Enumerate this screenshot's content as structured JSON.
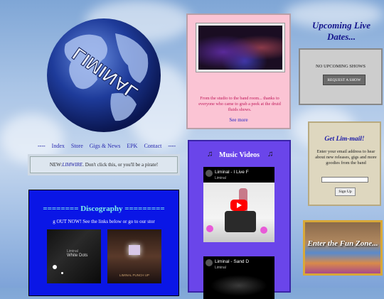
{
  "nav": {
    "dash_left": "----",
    "dash_right": "----",
    "items": [
      "Index",
      "Store",
      "Gigs & News",
      "EPK",
      "Contact"
    ]
  },
  "pirate": {
    "prefix": "NEW: ",
    "link": "LIMWIRE",
    "suffix": ". Don't click this, or you'll be a pirate!"
  },
  "discography": {
    "title": "========   Discography   =========",
    "subtitle": "g OUT NOW! See the links below or go to our stor",
    "albums": [
      {
        "line1": "Liminal",
        "line2": "White Dots"
      },
      {
        "line1": "",
        "line2": "LIMINAL PUNCH UP"
      }
    ]
  },
  "studio": {
    "text": "From the studio to the band room... thanks to everyone who came to grab a peek at the druid fluids shows.",
    "link": "See more"
  },
  "music": {
    "title": "Music Videos",
    "videos": [
      {
        "title": "Liminal - I Live F",
        "channel": "Liminal"
      },
      {
        "title": "Liminal - Sand D",
        "channel": "Liminal"
      }
    ]
  },
  "upcoming": {
    "title": "Upcoming Live Dates...",
    "none": "NO UPCOMING SHOWS",
    "button": "REQUEST A SHOW"
  },
  "limmail": {
    "title": "Get Lim-mail!",
    "text": "Enter your email address to hear about new releases, gigs and more goodies from the band",
    "input_value": "",
    "button": "Sign Up"
  },
  "funzone": {
    "text": "Enter the Fun Zone..."
  },
  "globe_text": "LIMINAL"
}
